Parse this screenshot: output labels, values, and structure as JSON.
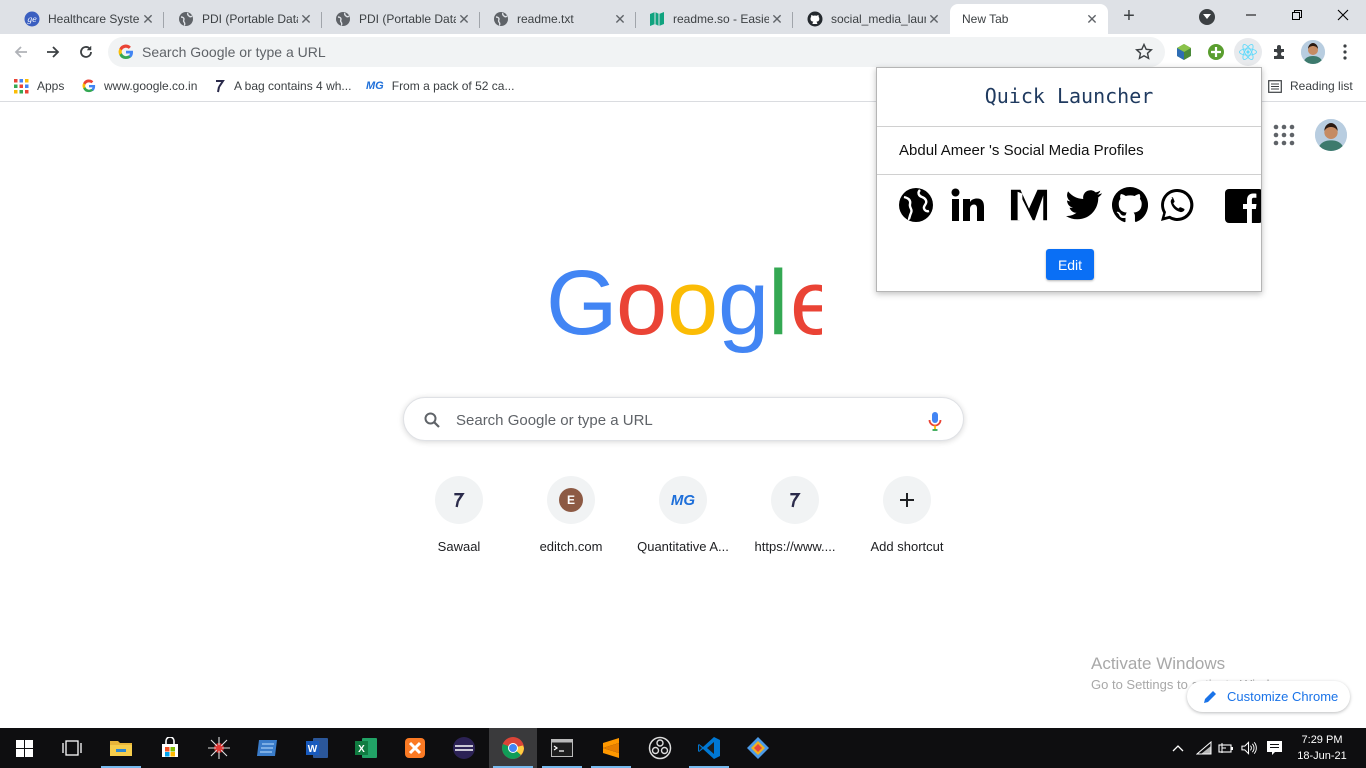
{
  "tabs": [
    {
      "title": "Healthcare System",
      "icon": "ge-icon"
    },
    {
      "title": "PDI (Portable Data",
      "icon": "globe-icon"
    },
    {
      "title": "PDI (Portable Data",
      "icon": "globe-icon"
    },
    {
      "title": "readme.txt",
      "icon": "globe-icon"
    },
    {
      "title": "readme.so - Easiest",
      "icon": "book-icon"
    },
    {
      "title": "social_media_laun",
      "icon": "github-icon"
    },
    {
      "title": "New Tab",
      "icon": "none"
    }
  ],
  "omnibox": {
    "placeholder": "Search Google or type a URL"
  },
  "bookmarks": [
    {
      "label": "Apps"
    },
    {
      "label": "www.google.co.in"
    },
    {
      "label": "A bag contains 4 wh..."
    },
    {
      "label": "From a pack of 52 ca..."
    }
  ],
  "reading_list": "Reading list",
  "ntp": {
    "search_placeholder": "Search Google or type a URL",
    "shortcuts": [
      {
        "label": "Sawaal",
        "icon": "sawaal-icon"
      },
      {
        "label": "editch.com",
        "letter": "E"
      },
      {
        "label": "Quantitative A...",
        "icon": "mg-icon"
      },
      {
        "label": "https://www....",
        "icon": "sawaal-icon"
      },
      {
        "label": "Add shortcut",
        "icon": "plus-icon"
      }
    ],
    "customize": "Customize Chrome"
  },
  "popup": {
    "title": "Quick Launcher",
    "subtitle": "Abdul Ameer 's Social Media Profiles",
    "icons": [
      "globe-icon",
      "linkedin-icon",
      "medium-icon",
      "twitter-icon",
      "github-icon",
      "whatsapp-icon",
      "facebook-icon"
    ],
    "edit": "Edit"
  },
  "watermark": {
    "line1": "Activate Windows",
    "line2": "Go to Settings to activate Windows."
  },
  "clock": {
    "time": "7:29 PM",
    "date": "18-Jun-21"
  },
  "colors": {
    "accent": "#1a73e8",
    "edit_button": "#0a6ff5",
    "tabstrip": "#dee1e6",
    "taskbar": "#0e0e10"
  }
}
